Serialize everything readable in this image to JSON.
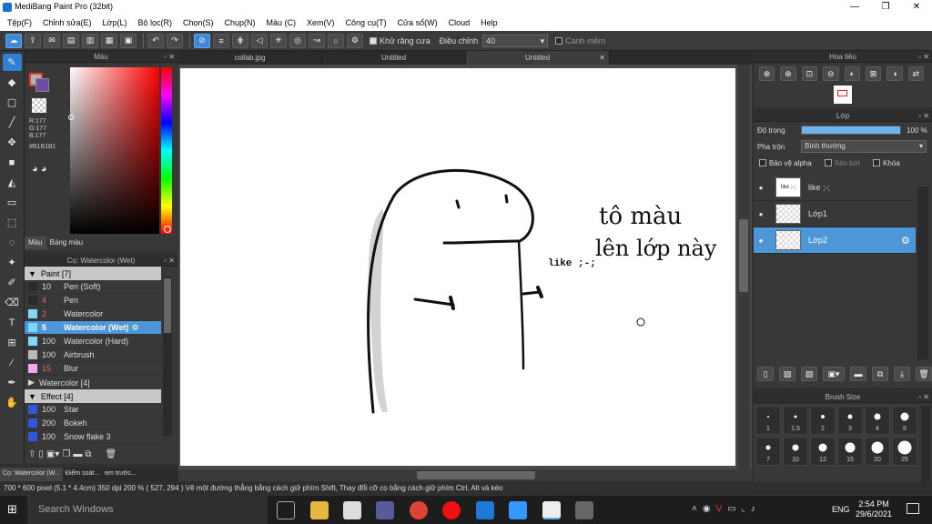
{
  "window": {
    "title": "MediBang Paint Pro (32bit)",
    "minimize": "—",
    "maximize": "❐",
    "close": "✕"
  },
  "menu": [
    "Tệp(F)",
    "Chỉnh sửa(E)",
    "Lớp(L)",
    "Bộ lọc(R)",
    "Chọn(S)",
    "Chụp(N)",
    "Màu (C)",
    "Xem(V)",
    "Công cụ(T)",
    "Cửa sổ(W)",
    "Cloud",
    "Help"
  ],
  "toolbar": {
    "antialias_label": "Khử răng cưa",
    "correction_label": "Điều chỉnh",
    "correction_value": "40",
    "smooth_label": "Canh mềm"
  },
  "color_panel": {
    "title": "Màu",
    "r": "R:177",
    "g": "G:177",
    "b": "B:177",
    "hex": "#B1B1B1",
    "tab_color": "Màu",
    "tab_palette": "Bảng màu",
    "primary": "#b1b1b1",
    "secondary": "#ffffff"
  },
  "brush_panel": {
    "title": "Cọ: Watercolor (Wet)",
    "groups": [
      {
        "name": "Paint [7]",
        "expanded": true,
        "items": [
          {
            "size": "10",
            "name": "Pen (Soft)",
            "color": "#2b2b2b"
          },
          {
            "size": "4",
            "name": "Pen",
            "color": "#2b2b2b"
          },
          {
            "size": "2",
            "name": "Watercolor",
            "color": "#7fd8f5"
          },
          {
            "size": "5",
            "name": "Watercolor (Wet)",
            "color": "#7fd8f5",
            "selected": true
          },
          {
            "size": "100",
            "name": "Watercolor (Hard)",
            "color": "#7fd8f5"
          },
          {
            "size": "100",
            "name": "Airbrush",
            "color": "#bbbbbb"
          },
          {
            "size": "15",
            "name": "Blur",
            "color": "#f0a8f0"
          }
        ]
      },
      {
        "name": "Watercolor [4]",
        "expanded": false,
        "items": []
      },
      {
        "name": "Effect [4]",
        "expanded": true,
        "items": [
          {
            "size": "100",
            "name": "Star",
            "color": "#3355dd"
          },
          {
            "size": "200",
            "name": "Bokeh",
            "color": "#3355dd"
          },
          {
            "size": "100",
            "name": "Snow flake 3",
            "color": "#3355dd"
          }
        ]
      }
    ],
    "bottom_tabs": [
      "Cọ: Watercolor (W...",
      "Điểm soát...",
      "em trước..."
    ]
  },
  "tabs": [
    "collab.jpg",
    "Untitled",
    "Untitled"
  ],
  "canvas": {
    "text_like": "like ;-;",
    "text_handwritten_1": "tô màu",
    "text_handwritten_2": "lên lớp này"
  },
  "navigator": {
    "title": "Hoa tiêu"
  },
  "layer_panel": {
    "title": "Lớp",
    "opacity_label": "Độ trong",
    "opacity_value": "100 %",
    "opacity": 1.0,
    "blend_label": "Pha trộn",
    "blend_value": "Bình thường",
    "protect_alpha": "Bảo vệ alpha",
    "clipping": "Xén bớt",
    "lock": "Khóa",
    "layers": [
      {
        "thumb": "like ;-;",
        "name": "like ;-;",
        "selected": false
      },
      {
        "name": "Lớp1",
        "selected": false
      },
      {
        "name": "Lớp2",
        "selected": true
      }
    ]
  },
  "brush_size_panel": {
    "title": "Brush Size",
    "row1": [
      "1",
      "1.5",
      "2",
      "3",
      "4",
      "5"
    ],
    "row2": [
      "7",
      "10",
      "12",
      "15",
      "20",
      "25"
    ]
  },
  "status": {
    "text": "700 * 600 pixel   (5.1 * 4.4cm)   350 dpi   200 %   ( 527, 294 )   Vẽ một đường thẳng bằng cách giữ phím Shift, Thay đổi cỡ cọ bằng cách giữ phím Ctrl, Alt và kéo"
  },
  "taskbar": {
    "search_placeholder": "Search Windows",
    "lang": "ENG",
    "time": "2:54 PM",
    "date": "29/6/2021"
  }
}
